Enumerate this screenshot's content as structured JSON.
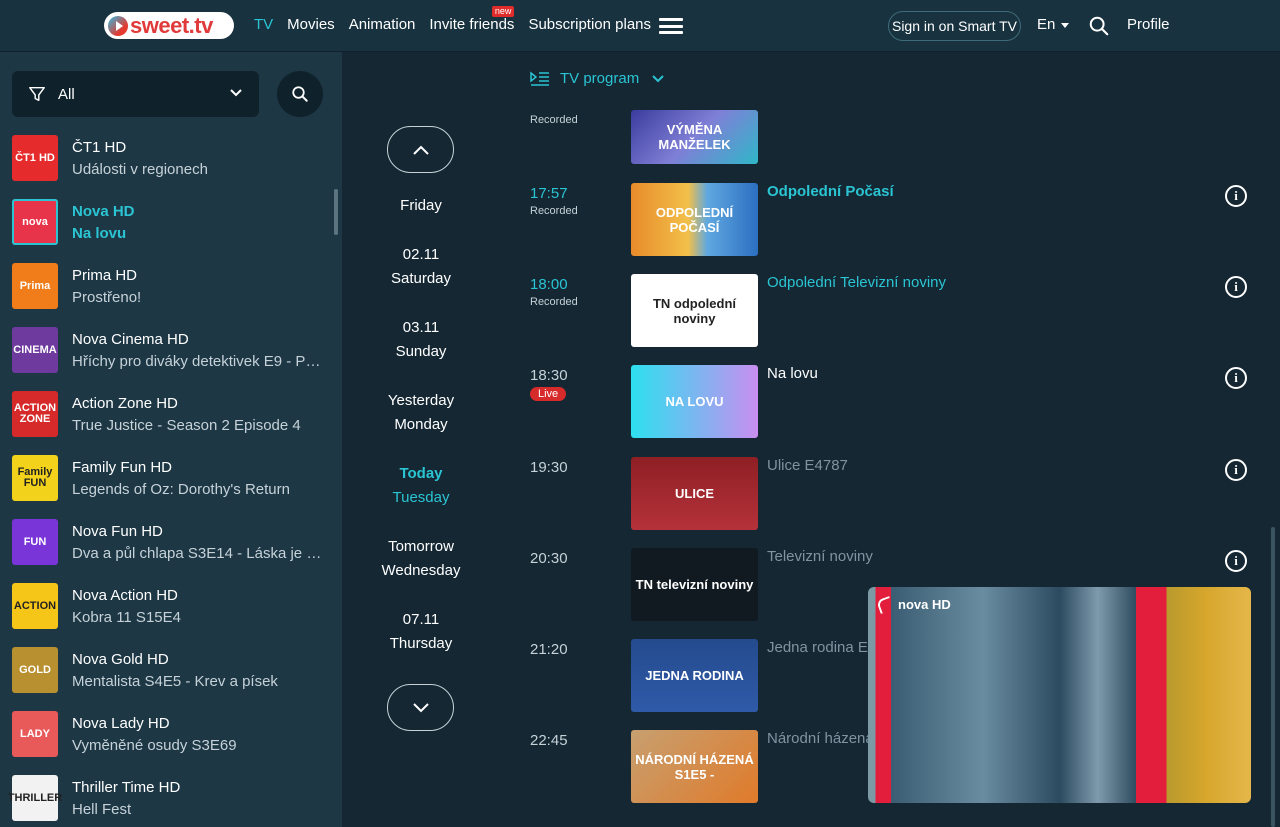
{
  "header": {
    "logo_text": "sweet.tv",
    "nav": [
      {
        "label": "TV",
        "active": true
      },
      {
        "label": "Movies"
      },
      {
        "label": "Animation"
      },
      {
        "label": "Invite friends",
        "badge": "new"
      },
      {
        "label": "Subscription plans"
      }
    ],
    "smart_tv_label": "Sign in on Smart TV",
    "language": "En",
    "profile_label": "Profile"
  },
  "sidebar": {
    "filter_label": "All",
    "channels": [
      {
        "name": "ČT1 HD",
        "program": "Události v regionech",
        "logo_text": "ČT1 HD",
        "logo_color": "#e52b2b"
      },
      {
        "name": "Nova HD",
        "program": "Na lovu",
        "logo_text": "nova",
        "logo_color": "#e8344a",
        "active": true
      },
      {
        "name": "Prima HD",
        "program": "Prostřeno!",
        "logo_text": "Prima",
        "logo_color": "#f07c1a"
      },
      {
        "name": "Nova Cinema HD",
        "program": "Hříchy pro diváky detektivek E9 - Pr...",
        "logo_text": "CINEMA",
        "logo_color": "#6e3a9e"
      },
      {
        "name": "Action Zone HD",
        "program": "True Justice - Season 2 Episode 4",
        "logo_text": "ACTION ZONE",
        "logo_color": "#d62a2a"
      },
      {
        "name": "Family Fun HD",
        "program": "Legends of Oz: Dorothy's Return",
        "logo_text": "Family FUN",
        "logo_color": "#f2d21a"
      },
      {
        "name": "Nova Fun HD",
        "program": "Dva a půl chlapa S3E14 - Láska je d...",
        "logo_text": "FUN",
        "logo_color": "#7a35d9"
      },
      {
        "name": "Nova Action HD",
        "program": "Kobra 11 S15E4",
        "logo_text": "ACTION",
        "logo_color": "#f5c518"
      },
      {
        "name": "Nova Gold HD",
        "program": "Mentalista S4E5 - Krev a písek",
        "logo_text": "GOLD",
        "logo_color": "#b8902f"
      },
      {
        "name": "Nova Lady HD",
        "program": "Vyměněné osudy S3E69",
        "logo_text": "LADY",
        "logo_color": "#e85a5a"
      },
      {
        "name": "Thriller Time HD",
        "program": "Hell Fest",
        "logo_text": "THRILLER",
        "logo_color": "#f2f2f2"
      }
    ]
  },
  "dates": [
    {
      "line1": "",
      "line2": "Friday"
    },
    {
      "line1": "02.11",
      "line2": "Saturday"
    },
    {
      "line1": "03.11",
      "line2": "Sunday"
    },
    {
      "line1": "Yesterday",
      "line2": "Monday"
    },
    {
      "line1": "Today",
      "line2": "Tuesday",
      "today": true
    },
    {
      "line1": "Tomorrow",
      "line2": "Wednesday"
    },
    {
      "line1": "07.11",
      "line2": "Thursday"
    }
  ],
  "program_header": "TV program",
  "programs": [
    {
      "time": "",
      "status": "Recorded",
      "title": "",
      "thumb_text": "VÝMĚNA MANŽELEK",
      "state": "past"
    },
    {
      "time": "17:57",
      "status": "Recorded",
      "title": "Odpolední Počasí",
      "thumb_text": "ODPOLEDNÍ POČASÍ",
      "state": "past"
    },
    {
      "time": "18:00",
      "status": "Recorded",
      "title": "Odpolední Televizní noviny",
      "thumb_text": "TN odpolední noviny",
      "state": "past"
    },
    {
      "time": "18:30",
      "status": "Live",
      "title": "Na lovu",
      "thumb_text": "NA LOVU",
      "state": "live"
    },
    {
      "time": "19:30",
      "status": "",
      "title": "Ulice E4787",
      "thumb_text": "ULICE",
      "state": "future"
    },
    {
      "time": "20:30",
      "status": "",
      "title": "Televizní noviny",
      "thumb_text": "TN televizní noviny",
      "state": "future"
    },
    {
      "time": "21:20",
      "status": "",
      "title": "Jedna rodina E",
      "thumb_text": "JEDNA RODINA",
      "state": "future"
    },
    {
      "time": "22:45",
      "status": "",
      "title": "Národní házená",
      "thumb_text": "NÁRODNÍ HÁZENÁ S1E5 -",
      "state": "future"
    }
  ],
  "player": {
    "channel_logo": "nova HD"
  },
  "colors": {
    "accent": "#2bc4d3",
    "background": "#142733",
    "sidebar": "#1d3745",
    "live": "#d72a2a"
  }
}
